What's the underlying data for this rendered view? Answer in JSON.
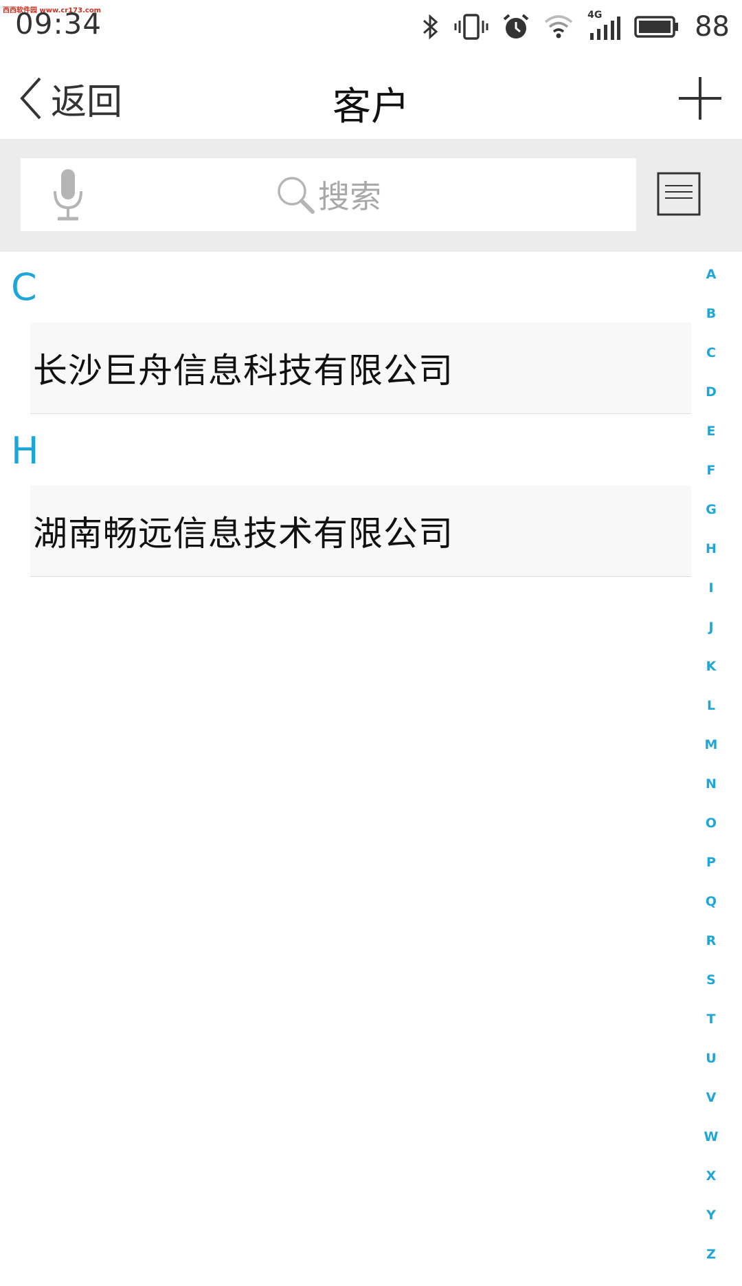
{
  "watermark": "西西软件园 www.cr173.com",
  "status_bar": {
    "time": "09:34",
    "network": "4G",
    "battery": "88"
  },
  "header": {
    "back_label": "返回",
    "title": "客户"
  },
  "search": {
    "placeholder": "搜索"
  },
  "sections": [
    {
      "letter": "C",
      "items": [
        "长沙巨舟信息科技有限公司"
      ]
    },
    {
      "letter": "H",
      "items": [
        "湖南畅远信息技术有限公司"
      ]
    }
  ],
  "index_letters": [
    "A",
    "B",
    "C",
    "D",
    "E",
    "F",
    "G",
    "H",
    "I",
    "J",
    "K",
    "L",
    "M",
    "N",
    "O",
    "P",
    "Q",
    "R",
    "S",
    "T",
    "U",
    "V",
    "W",
    "X",
    "Y",
    "Z"
  ],
  "colors": {
    "accent": "#1ea6d8",
    "band": "#ececec",
    "item_bg": "#f8f8f8"
  }
}
